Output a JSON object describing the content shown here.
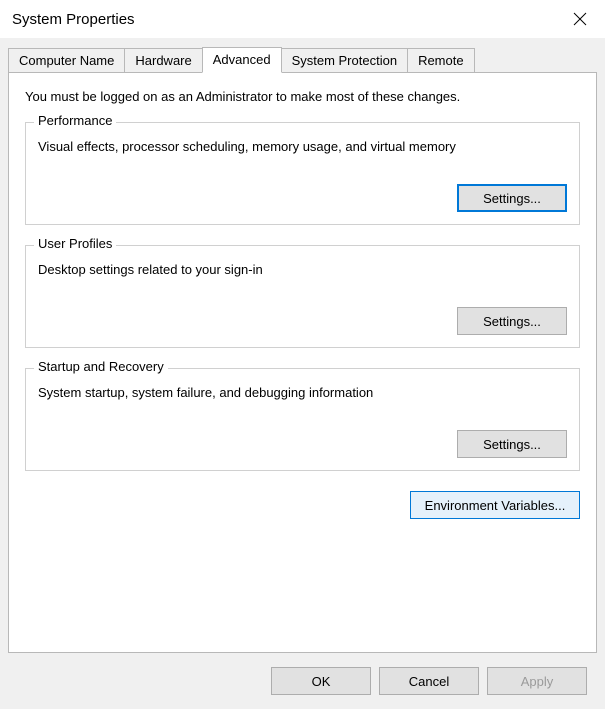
{
  "window": {
    "title": "System Properties"
  },
  "tabs": {
    "computer_name": "Computer Name",
    "hardware": "Hardware",
    "advanced": "Advanced",
    "system_protection": "System Protection",
    "remote": "Remote",
    "active": "advanced"
  },
  "advanced_tab": {
    "admin_note": "You must be logged on as an Administrator to make most of these changes.",
    "performance": {
      "legend": "Performance",
      "desc": "Visual effects, processor scheduling, memory usage, and virtual memory",
      "button": "Settings..."
    },
    "user_profiles": {
      "legend": "User Profiles",
      "desc": "Desktop settings related to your sign-in",
      "button": "Settings..."
    },
    "startup_recovery": {
      "legend": "Startup and Recovery",
      "desc": "System startup, system failure, and debugging information",
      "button": "Settings..."
    },
    "env_vars_button": "Environment Variables..."
  },
  "footer": {
    "ok": "OK",
    "cancel": "Cancel",
    "apply": "Apply"
  }
}
